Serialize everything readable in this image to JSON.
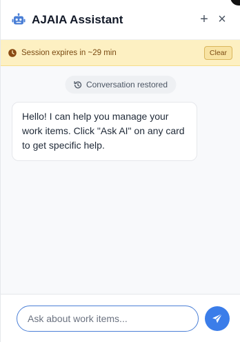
{
  "header": {
    "title": "AJAIA Assistant",
    "icon": "robot-icon",
    "new_chat_symbol": "+",
    "close_symbol": "×"
  },
  "session_banner": {
    "icon": "clock-icon",
    "text": "Session expires in ~29 min",
    "clear_label": "Clear"
  },
  "chat": {
    "status_icon": "history-icon",
    "status_text": "Conversation restored",
    "messages": [
      {
        "role": "assistant",
        "text": "Hello! I can help you manage your work items. Click \"Ask AI\" on any card to get specific help."
      }
    ]
  },
  "composer": {
    "placeholder": "Ask about work items...",
    "value": "",
    "send_icon": "send-icon"
  },
  "colors": {
    "accent": "#3b7de9",
    "banner_bg": "#fdf0c2",
    "banner_text": "#7a4a12",
    "robot_icon": "#4a7fd6"
  }
}
